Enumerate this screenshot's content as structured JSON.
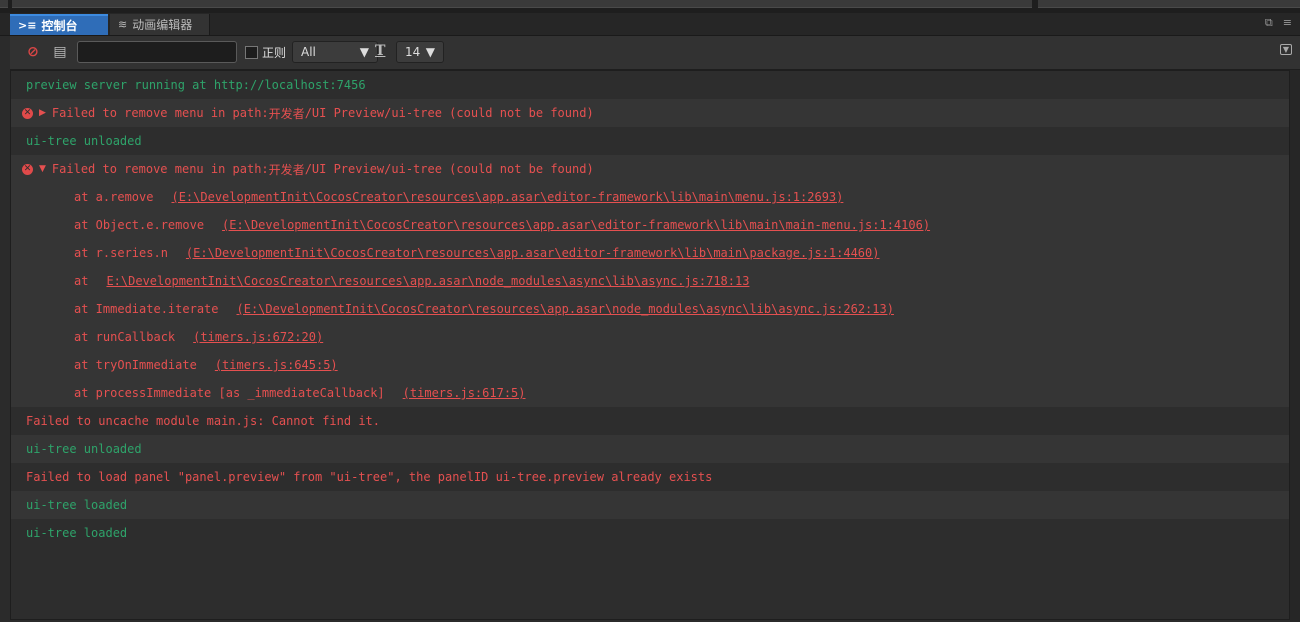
{
  "tabs": [
    {
      "label": "控制台",
      "icon": "console-icon",
      "active": true
    },
    {
      "label": "动画编辑器",
      "icon": "animation-icon",
      "active": false
    }
  ],
  "toolbar": {
    "filter_value": "",
    "regex_label": "正则",
    "level_value": "All",
    "font_size_value": "14"
  },
  "log": {
    "l1": "preview server running at http://localhost:7456",
    "l2_prefix": "Failed to remove menu in path: ",
    "l2_cjk": "开发者",
    "l2_suffix": "/UI Preview/ui-tree (could not be found)",
    "l3": "ui-tree unloaded",
    "l4_prefix": "Failed to remove menu in path: ",
    "l4_cjk": "开发者",
    "l4_suffix": "/UI Preview/ui-tree (could not be found)",
    "stack": [
      {
        "fn": "at a.remove",
        "loc": "(E:\\DevelopmentInit\\CocosCreator\\resources\\app.asar\\editor-framework\\lib\\main\\menu.js:1:2693)"
      },
      {
        "fn": "at Object.e.remove",
        "loc": "(E:\\DevelopmentInit\\CocosCreator\\resources\\app.asar\\editor-framework\\lib\\main\\main-menu.js:1:4106)"
      },
      {
        "fn": "at r.series.n",
        "loc": "(E:\\DevelopmentInit\\CocosCreator\\resources\\app.asar\\editor-framework\\lib\\main\\package.js:1:4460)"
      },
      {
        "fn": "at",
        "loc": "E:\\DevelopmentInit\\CocosCreator\\resources\\app.asar\\node_modules\\async\\lib\\async.js:718:13"
      },
      {
        "fn": "at Immediate.iterate",
        "loc": "(E:\\DevelopmentInit\\CocosCreator\\resources\\app.asar\\node_modules\\async\\lib\\async.js:262:13)"
      },
      {
        "fn": "at runCallback",
        "loc": "(timers.js:672:20)"
      },
      {
        "fn": "at tryOnImmediate",
        "loc": "(timers.js:645:5)"
      },
      {
        "fn": "at processImmediate [as _immediateCallback]",
        "loc": "(timers.js:617:5)"
      }
    ],
    "l5": "Failed to uncache module main.js: Cannot find it.",
    "l6": "ui-tree unloaded",
    "l7": "Failed to load panel \"panel.preview\" from \"ui-tree\", the panelID ui-tree.preview already exists",
    "l8": "ui-tree loaded",
    "l9": "ui-tree loaded"
  },
  "colors": {
    "tab_active": "#2f6db8",
    "log_info": "#2ea36a",
    "log_error": "#e55050"
  }
}
